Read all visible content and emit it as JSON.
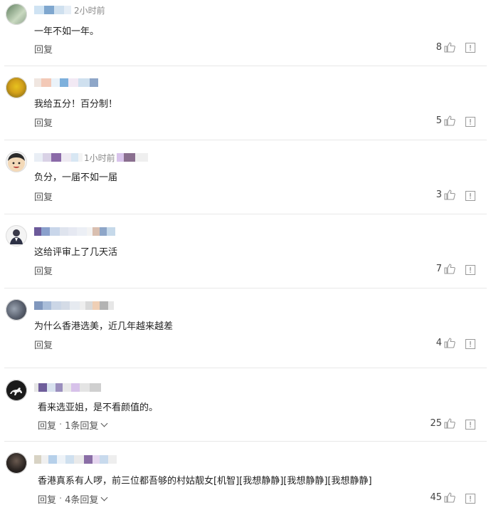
{
  "comments": [
    {
      "time": "2小时前",
      "text": "一年不如一年。",
      "reply": "回复",
      "likes": "8"
    },
    {
      "text": "我给五分！百分制！",
      "reply": "回复",
      "likes": "5"
    },
    {
      "name_tail": "1小时前",
      "text": "负分，一届不如一届",
      "reply": "回复",
      "likes": "3"
    },
    {
      "text": "这给评审上了几天活",
      "reply": "回复",
      "likes": "7"
    },
    {
      "text": "为什么香港选美，近几年越来越差",
      "reply": "回复",
      "likes": "4"
    },
    {
      "text": "看来选亚姐，是不看颜值的。",
      "reply": "回复",
      "more": "1条回复",
      "likes": "25"
    },
    {
      "text": "香港真系有人啰，前三位都吾够的村姑靓女[机智][我想静静][我想静静][我想静静]",
      "reply": "回复",
      "more": "4条回复",
      "likes": "45"
    }
  ],
  "colors": {
    "divider": "#e8e8e8",
    "text": "#222222",
    "muted": "#555555"
  },
  "icons": {
    "like": "thumbs-up-icon",
    "report": "report-icon",
    "expand": "chevron-down-icon"
  }
}
